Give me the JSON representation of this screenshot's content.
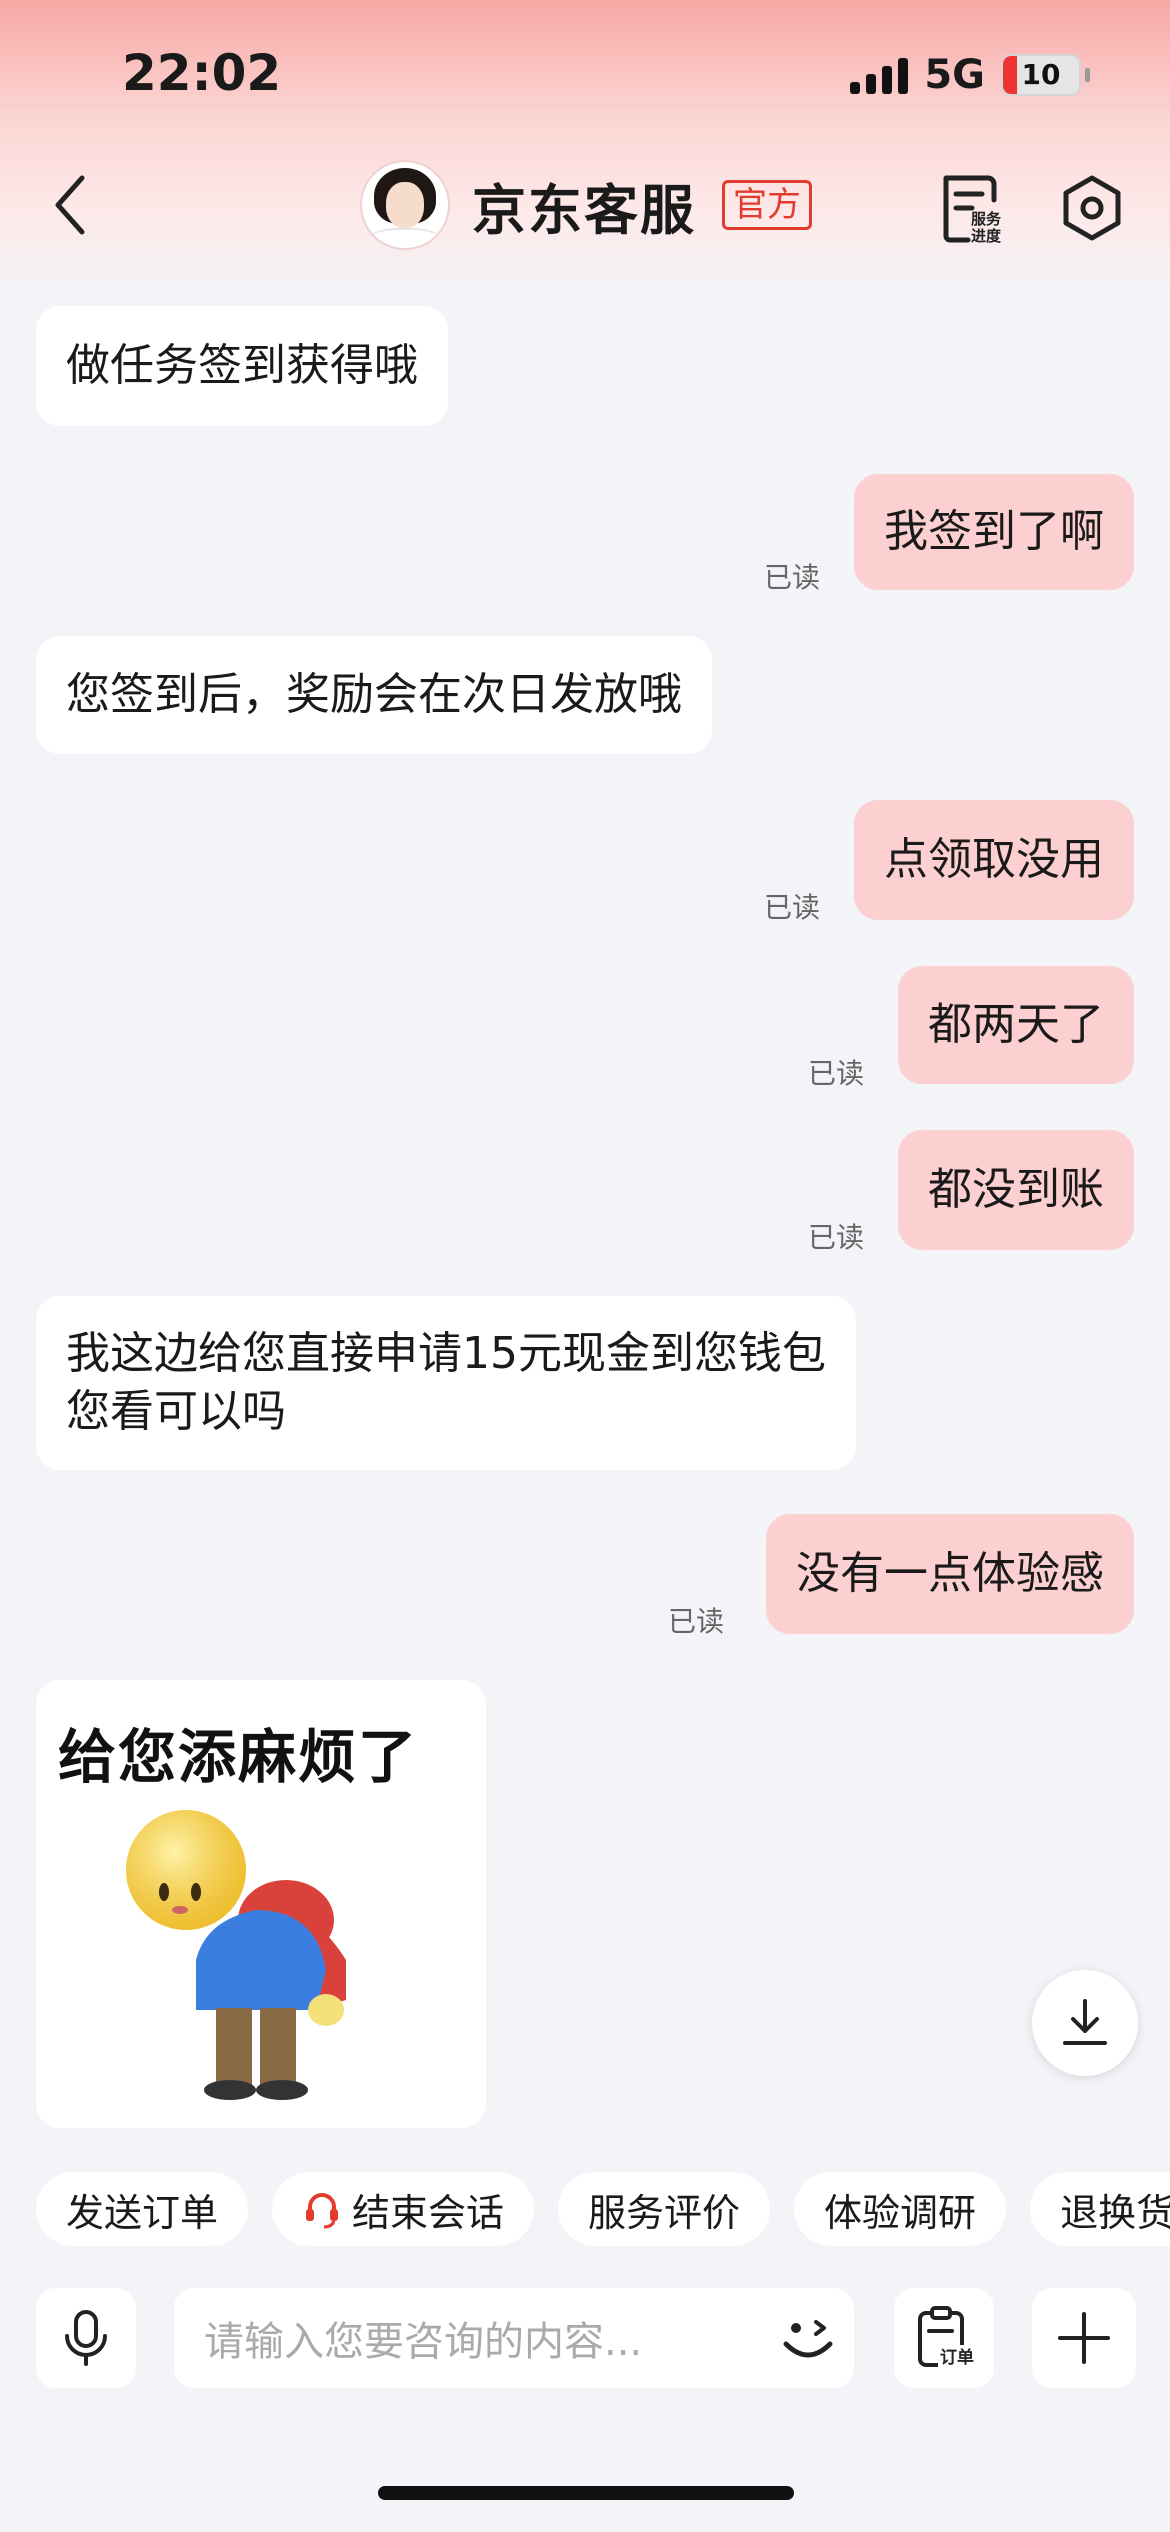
{
  "status_bar": {
    "time": "22:02",
    "network": "5G",
    "battery": "10"
  },
  "header": {
    "title": "京东客服",
    "official_badge": "官方",
    "progress_label_1": "服务",
    "progress_label_2": "进度"
  },
  "messages": [
    {
      "side": "in",
      "text": "做任务签到获得哦"
    },
    {
      "side": "out",
      "text": "我签到了啊",
      "status": "已读"
    },
    {
      "side": "in",
      "text": "您签到后，奖励会在次日发放哦"
    },
    {
      "side": "out",
      "text": "点领取没用",
      "status": "已读"
    },
    {
      "side": "out",
      "text": "都两天了",
      "status": "已读"
    },
    {
      "side": "out",
      "text": "都没到账",
      "status": "已读"
    },
    {
      "side": "in",
      "line1": "我这边给您直接申请15元现金到您钱包",
      "line2": "您看可以吗"
    },
    {
      "side": "out",
      "text": "没有一点体验感",
      "status": "已读"
    }
  ],
  "sticker": {
    "caption": "给您添麻烦了"
  },
  "quick_actions": [
    "发送订单",
    "结束会话",
    "服务评价",
    "体验调研",
    "退换货"
  ],
  "input": {
    "placeholder": "请输入您要咨询的内容...",
    "order_label": "订单"
  },
  "icons": {
    "back": "chevron-left-icon",
    "settings": "hexagon-settings-icon",
    "progress": "service-progress-icon",
    "mic": "microphone-icon",
    "emoji": "wink-emoji-icon",
    "order": "clipboard-order-icon",
    "plus": "plus-icon",
    "download": "download-icon",
    "headset": "headset-icon"
  },
  "colors": {
    "outgoing_bubble": "#fcd0d0",
    "incoming_bubble": "#ffffff",
    "accent_red": "#e33b2e",
    "background": "#f3f4f8"
  }
}
